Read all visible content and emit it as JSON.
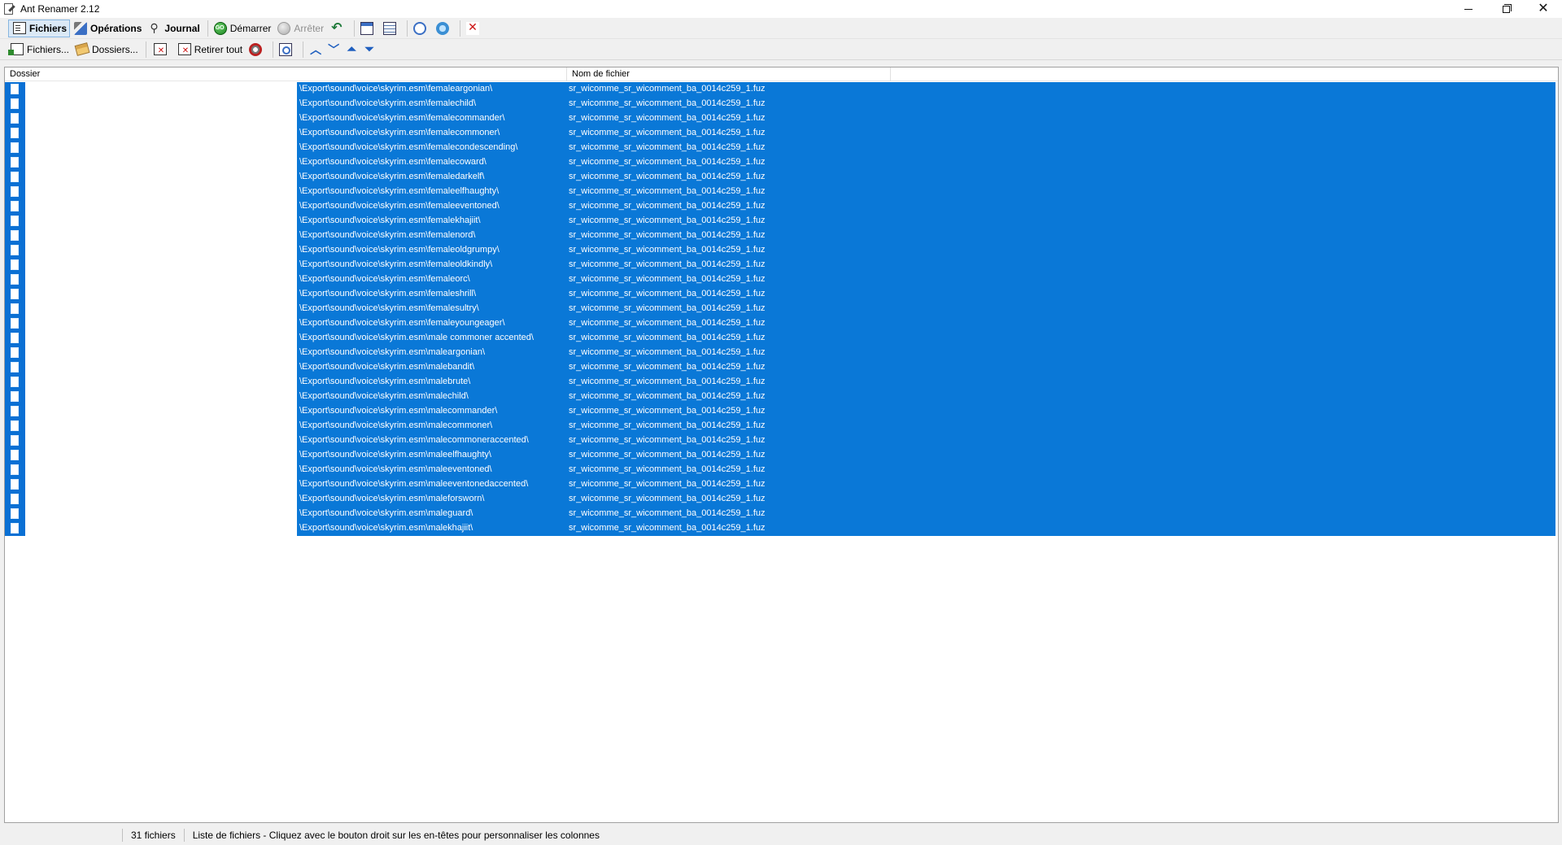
{
  "window": {
    "title": "Ant Renamer 2.12"
  },
  "toolbar1": {
    "files_tab": "Fichiers",
    "operations_tab": "Opérations",
    "journal_tab": "Journal",
    "start": "Démarrer",
    "stop": "Arrêter"
  },
  "toolbar2": {
    "add_files": "Fichiers...",
    "add_folders": "Dossiers...",
    "remove_all": "Retirer tout"
  },
  "columns": {
    "dossier": "Dossier",
    "nom": "Nom de fichier"
  },
  "rows": [
    {
      "dossier": "\\Export\\sound\\voice\\skyrim.esm\\femaleargonian\\",
      "nom": "sr_wicomme_sr_wicomment_ba_0014c259_1.fuz"
    },
    {
      "dossier": "\\Export\\sound\\voice\\skyrim.esm\\femalechild\\",
      "nom": "sr_wicomme_sr_wicomment_ba_0014c259_1.fuz"
    },
    {
      "dossier": "\\Export\\sound\\voice\\skyrim.esm\\femalecommander\\",
      "nom": "sr_wicomme_sr_wicomment_ba_0014c259_1.fuz"
    },
    {
      "dossier": "\\Export\\sound\\voice\\skyrim.esm\\femalecommoner\\",
      "nom": "sr_wicomme_sr_wicomment_ba_0014c259_1.fuz"
    },
    {
      "dossier": "\\Export\\sound\\voice\\skyrim.esm\\femalecondescending\\",
      "nom": "sr_wicomme_sr_wicomment_ba_0014c259_1.fuz"
    },
    {
      "dossier": "\\Export\\sound\\voice\\skyrim.esm\\femalecoward\\",
      "nom": "sr_wicomme_sr_wicomment_ba_0014c259_1.fuz"
    },
    {
      "dossier": "\\Export\\sound\\voice\\skyrim.esm\\femaledarkelf\\",
      "nom": "sr_wicomme_sr_wicomment_ba_0014c259_1.fuz"
    },
    {
      "dossier": "\\Export\\sound\\voice\\skyrim.esm\\femaleelfhaughty\\",
      "nom": "sr_wicomme_sr_wicomment_ba_0014c259_1.fuz"
    },
    {
      "dossier": "\\Export\\sound\\voice\\skyrim.esm\\femaleeventoned\\",
      "nom": "sr_wicomme_sr_wicomment_ba_0014c259_1.fuz"
    },
    {
      "dossier": "\\Export\\sound\\voice\\skyrim.esm\\femalekhajiit\\",
      "nom": "sr_wicomme_sr_wicomment_ba_0014c259_1.fuz"
    },
    {
      "dossier": "\\Export\\sound\\voice\\skyrim.esm\\femalenord\\",
      "nom": "sr_wicomme_sr_wicomment_ba_0014c259_1.fuz"
    },
    {
      "dossier": "\\Export\\sound\\voice\\skyrim.esm\\femaleoldgrumpy\\",
      "nom": "sr_wicomme_sr_wicomment_ba_0014c259_1.fuz"
    },
    {
      "dossier": "\\Export\\sound\\voice\\skyrim.esm\\femaleoldkindly\\",
      "nom": "sr_wicomme_sr_wicomment_ba_0014c259_1.fuz"
    },
    {
      "dossier": "\\Export\\sound\\voice\\skyrim.esm\\femaleorc\\",
      "nom": "sr_wicomme_sr_wicomment_ba_0014c259_1.fuz"
    },
    {
      "dossier": "\\Export\\sound\\voice\\skyrim.esm\\femaleshrill\\",
      "nom": "sr_wicomme_sr_wicomment_ba_0014c259_1.fuz"
    },
    {
      "dossier": "\\Export\\sound\\voice\\skyrim.esm\\femalesultry\\",
      "nom": "sr_wicomme_sr_wicomment_ba_0014c259_1.fuz"
    },
    {
      "dossier": "\\Export\\sound\\voice\\skyrim.esm\\femaleyoungeager\\",
      "nom": "sr_wicomme_sr_wicomment_ba_0014c259_1.fuz"
    },
    {
      "dossier": "\\Export\\sound\\voice\\skyrim.esm\\male commoner accented\\",
      "nom": "sr_wicomme_sr_wicomment_ba_0014c259_1.fuz"
    },
    {
      "dossier": "\\Export\\sound\\voice\\skyrim.esm\\maleargonian\\",
      "nom": "sr_wicomme_sr_wicomment_ba_0014c259_1.fuz"
    },
    {
      "dossier": "\\Export\\sound\\voice\\skyrim.esm\\malebandit\\",
      "nom": "sr_wicomme_sr_wicomment_ba_0014c259_1.fuz"
    },
    {
      "dossier": "\\Export\\sound\\voice\\skyrim.esm\\malebrute\\",
      "nom": "sr_wicomme_sr_wicomment_ba_0014c259_1.fuz"
    },
    {
      "dossier": "\\Export\\sound\\voice\\skyrim.esm\\malechild\\",
      "nom": "sr_wicomme_sr_wicomment_ba_0014c259_1.fuz"
    },
    {
      "dossier": "\\Export\\sound\\voice\\skyrim.esm\\malecommander\\",
      "nom": "sr_wicomme_sr_wicomment_ba_0014c259_1.fuz"
    },
    {
      "dossier": "\\Export\\sound\\voice\\skyrim.esm\\malecommoner\\",
      "nom": "sr_wicomme_sr_wicomment_ba_0014c259_1.fuz"
    },
    {
      "dossier": "\\Export\\sound\\voice\\skyrim.esm\\malecommoneraccented\\",
      "nom": "sr_wicomme_sr_wicomment_ba_0014c259_1.fuz"
    },
    {
      "dossier": "\\Export\\sound\\voice\\skyrim.esm\\maleelfhaughty\\",
      "nom": "sr_wicomme_sr_wicomment_ba_0014c259_1.fuz"
    },
    {
      "dossier": "\\Export\\sound\\voice\\skyrim.esm\\maleeventoned\\",
      "nom": "sr_wicomme_sr_wicomment_ba_0014c259_1.fuz"
    },
    {
      "dossier": "\\Export\\sound\\voice\\skyrim.esm\\maleeventonedaccented\\",
      "nom": "sr_wicomme_sr_wicomment_ba_0014c259_1.fuz"
    },
    {
      "dossier": "\\Export\\sound\\voice\\skyrim.esm\\maleforsworn\\",
      "nom": "sr_wicomme_sr_wicomment_ba_0014c259_1.fuz"
    },
    {
      "dossier": "\\Export\\sound\\voice\\skyrim.esm\\maleguard\\",
      "nom": "sr_wicomme_sr_wicomment_ba_0014c259_1.fuz"
    },
    {
      "dossier": "\\Export\\sound\\voice\\skyrim.esm\\malekhajiit\\",
      "nom": "sr_wicomme_sr_wicomment_ba_0014c259_1.fuz"
    }
  ],
  "status": {
    "count": "31 fichiers",
    "message": "Liste de fichiers - Cliquez avec le bouton droit sur les en-têtes pour personnaliser les colonnes"
  },
  "colors": {
    "selection": "#0a78d7",
    "icon_column": "#0a70d4"
  }
}
